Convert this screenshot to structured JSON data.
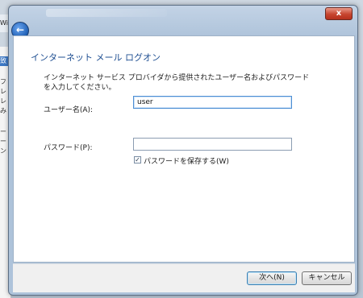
{
  "background": {
    "top_strip_text": "Wi",
    "left_items": [
      "",
      "",
      "致",
      "フ",
      "レ",
      "レ",
      "み",
      "",
      "",
      "",
      "ー",
      "ー",
      "ン"
    ]
  },
  "dialog": {
    "heading": "インターネット メール ログオン",
    "description": "インターネット サービス プロバイダから提供されたユーザー名およびパスワードを入力してください。",
    "username": {
      "label": "ユーザー名(A):",
      "value": "user"
    },
    "password": {
      "label": "パスワード(P):",
      "value": ""
    },
    "remember": {
      "label": "パスワードを保存する(W)",
      "checked": true,
      "mark": "✓"
    },
    "buttons": {
      "next": "次へ(N)",
      "cancel": "キャンセル"
    },
    "close_glyph": "x",
    "back_glyph": "←"
  }
}
